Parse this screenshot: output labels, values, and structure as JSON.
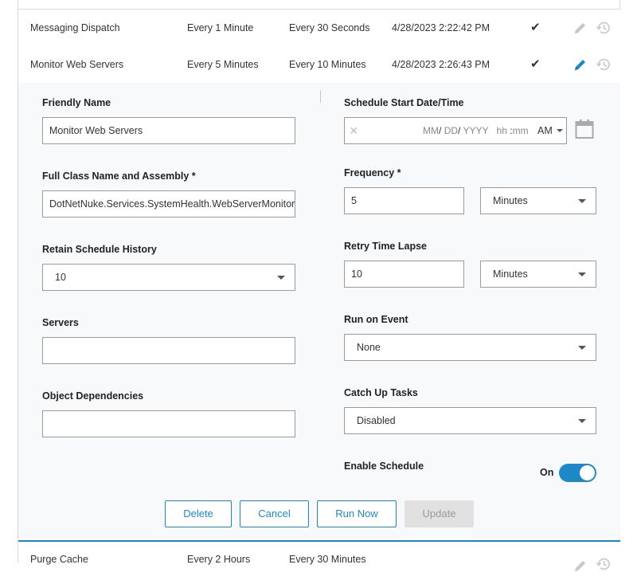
{
  "rows": [
    {
      "name": "Messaging Dispatch",
      "frequency": "Every 1 Minute",
      "retry": "Every 30 Seconds",
      "next_start": "4/28/2023 2:22:42 PM",
      "enabled_mark": "✔"
    },
    {
      "name": "Monitor Web Servers",
      "frequency": "Every 5 Minutes",
      "retry": "Every 10 Minutes",
      "next_start": "4/28/2023 2:26:43 PM",
      "enabled_mark": "✔"
    },
    {
      "name": "Purge Cache",
      "frequency": "Every 2 Hours",
      "retry": "Every 30 Minutes",
      "next_start": "",
      "enabled_mark": ""
    }
  ],
  "form": {
    "friendly_name": {
      "label": "Friendly Name",
      "value": "Monitor Web Servers"
    },
    "class_name": {
      "label": "Full Class Name and Assembly *",
      "value": "DotNetNuke.Services.SystemHealth.WebServerMonitor, DotNetNuke"
    },
    "retain_history": {
      "label": "Retain Schedule History",
      "value": "10"
    },
    "servers": {
      "label": "Servers",
      "value": ""
    },
    "object_dependencies": {
      "label": "Object Dependencies",
      "value": ""
    },
    "schedule_start": {
      "label": "Schedule Start Date/Time",
      "clear": "×",
      "mm": "MM",
      "dd": "DD",
      "yyyy": "YYYY",
      "hh": "hh",
      "min": "mm",
      "sep_date": "/",
      "sep_time": ":",
      "ampm": "AM"
    },
    "frequency": {
      "label": "Frequency *",
      "value": "5",
      "unit": "Minutes"
    },
    "retry_lapse": {
      "label": "Retry Time Lapse",
      "value": "10",
      "unit": "Minutes"
    },
    "run_on_event": {
      "label": "Run on Event",
      "value": "None"
    },
    "catch_up": {
      "label": "Catch Up Tasks",
      "value": "Disabled"
    },
    "enable_schedule": {
      "label": "Enable Schedule",
      "state": "On",
      "on": true
    }
  },
  "buttons": {
    "delete": "Delete",
    "cancel": "Cancel",
    "run_now": "Run Now",
    "update": "Update"
  },
  "colors": {
    "accent": "#1e88c7",
    "panel_bg": "#f7f9fa",
    "disabled_button": "#e1e1e1"
  },
  "icons": {
    "edit": "pencil-icon",
    "history": "history-icon",
    "check": "check-icon",
    "calendar": "calendar-icon",
    "clear": "clear-icon",
    "caret": "chevron-down-icon"
  }
}
